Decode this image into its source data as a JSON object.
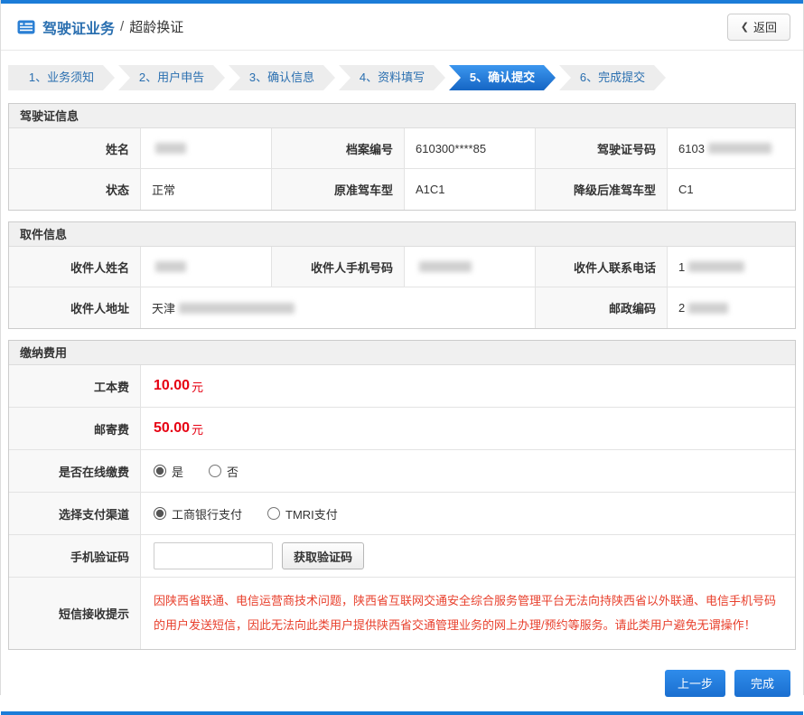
{
  "header": {
    "title": "驾驶证业务",
    "separator": "/",
    "subtitle": "超龄换证",
    "back": "返回"
  },
  "steps": {
    "s1": "1、业务须知",
    "s2": "2、用户申告",
    "s3": "3、确认信息",
    "s4": "4、资料填写",
    "s5": "5、确认提交",
    "s6": "6、完成提交"
  },
  "license": {
    "title": "驾驶证信息",
    "name_label": "姓名",
    "file_label": "档案编号",
    "file_value": "610300****85",
    "number_label": "驾驶证号码",
    "number_value": "6103",
    "status_label": "状态",
    "status_value": "正常",
    "orig_label": "原准驾车型",
    "orig_value": "A1C1",
    "down_label": "降级后准驾车型",
    "down_value": "C1"
  },
  "pickup": {
    "title": "取件信息",
    "name_label": "收件人姓名",
    "mobile_label": "收件人手机号码",
    "tel_label": "收件人联系电话",
    "tel_value": "1",
    "addr_label": "收件人地址",
    "addr_value": "天津",
    "zip_label": "邮政编码",
    "zip_value": "2"
  },
  "fees": {
    "title": "缴纳费用",
    "cost_label": "工本费",
    "cost_value": "10.00",
    "cost_unit": "元",
    "post_label": "邮寄费",
    "post_value": "50.00",
    "post_unit": "元",
    "online_label": "是否在线缴费",
    "online_yes": "是",
    "online_no": "否",
    "channel_label": "选择支付渠道",
    "channel_icbc": "工商银行支付",
    "channel_tmri": "TMRI支付",
    "code_label": "手机验证码",
    "code_button": "获取验证码",
    "notice_label": "短信接收提示",
    "notice_text": "因陕西省联通、电信运营商技术问题，陕西省互联网交通安全综合服务管理平台无法向持陕西省以外联通、电信手机号码的用户发送短信，因此无法向此类用户提供陕西省交通管理业务的网上办理/预约等服务。请此类用户避免无谓操作！"
  },
  "footer": {
    "prev": "上一步",
    "done": "完成"
  },
  "colors": {
    "accent": "#1b7cd8",
    "fee_red": "#e60012",
    "notice_red": "#e8402d",
    "step_active": "#1e7ae0"
  }
}
